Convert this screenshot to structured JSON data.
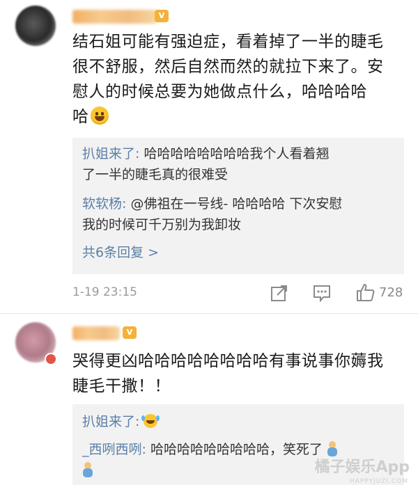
{
  "comments": [
    {
      "text_line1": "结石姐可能有强迫症，看着掉了一半的睫毛",
      "text_line2": "很不舒服，然后自然而然的就拉下来了。安",
      "text_line3": "慰人的时候总要为她做点什么，哈哈哈哈",
      "text_line4": "哈",
      "replies": [
        {
          "name": "扒姐来了:",
          "text_a": "哈哈哈哈哈哈哈哈我个人看着翘",
          "text_b": "了一半的睫毛真的很难受"
        },
        {
          "name": "软软杨:",
          "text_a": "@佛祖在一号线- 哈哈哈哈 下次安慰",
          "text_b": "我的时候可千万别为我卸妆"
        }
      ],
      "more_label": "共6条回复 >",
      "time": "1-19 23:15",
      "like_count": "728"
    },
    {
      "text_line1": "哭得更凶哈哈哈哈哈哈哈哈有事说事你薅我",
      "text_line2": "睫毛干撒！！",
      "replies": [
        {
          "name": "扒姐来了:",
          "text_a": ""
        },
        {
          "name": "_西咧西咧:",
          "text_a": "哈哈哈哈哈哈哈哈哈，笑死了"
        }
      ]
    }
  ],
  "icons": {
    "share": "share-icon",
    "comment": "comment-icon",
    "like": "thumbs-up-icon",
    "laugh": "laughing-emoji-icon",
    "cry_laugh": "tears-of-joy-emoji-icon",
    "doll": "doll-emoji-icon"
  },
  "colors": {
    "reply_name": "#5a7fa8",
    "reply_bg": "#f2f2f2",
    "meta": "#9a9a9a"
  },
  "watermark": {
    "main": "橘子娱乐App",
    "sub": "HAPPYJUZI.COM"
  }
}
